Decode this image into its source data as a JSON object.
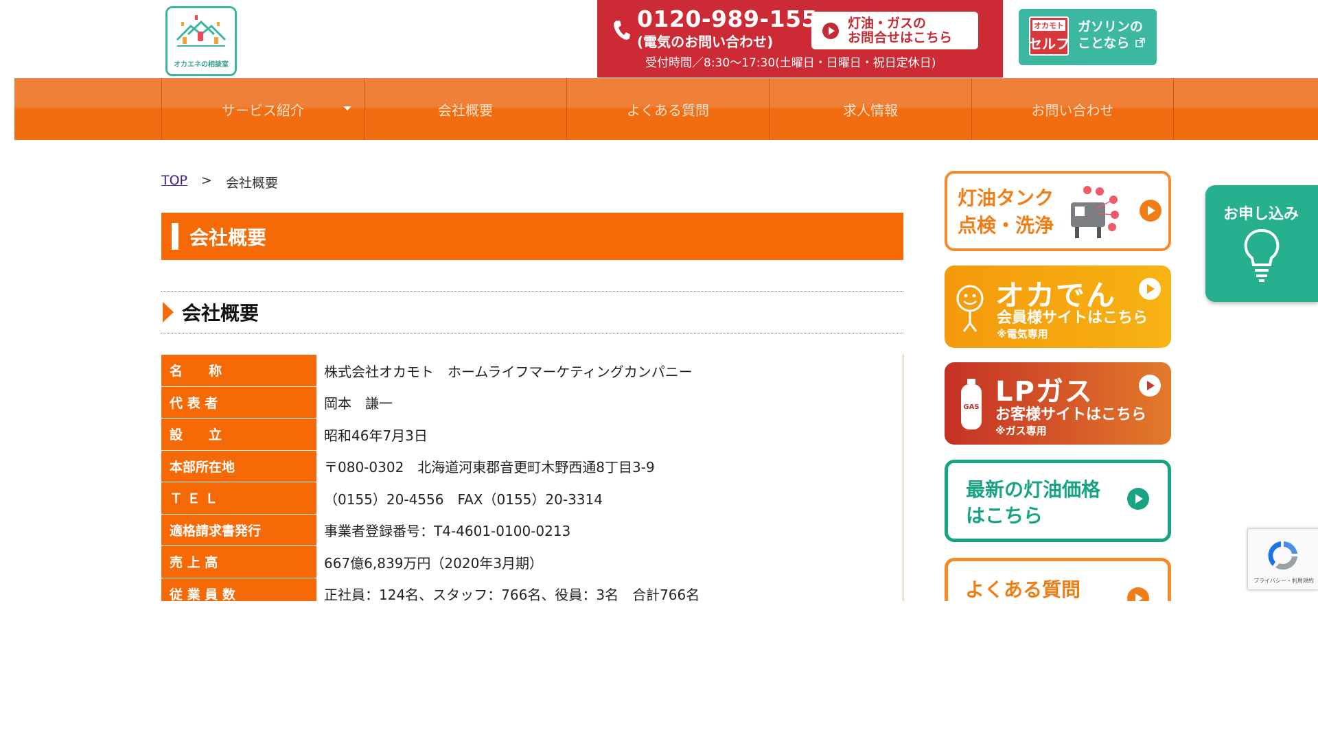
{
  "header": {
    "logo_text": "オカエネの相談室",
    "phone": {
      "number": "0120-989-155",
      "note": "(電気のお問い合わせ)",
      "hours": "受付時間／8:30〜17:30(土曜日・日曜日・祝日定休日)",
      "inquiry_button": "灯油・ガスの\nお問合せはこちら"
    },
    "gasoline": {
      "brand_top": "オカモト",
      "brand_main": "セルフ",
      "label": "ガソリンの\nことなら"
    }
  },
  "nav": {
    "items": [
      {
        "label": "サービス紹介"
      },
      {
        "label": "会社概要"
      },
      {
        "label": "よくある質問"
      },
      {
        "label": "求人情報"
      },
      {
        "label": "お問い合わせ"
      },
      {
        "label": ""
      }
    ]
  },
  "breadcrumb": {
    "top": "TOP",
    "separator": ">",
    "current": "会社概要"
  },
  "main": {
    "page_title": "会社概要",
    "section_title": "会社概要",
    "company_info": [
      {
        "key": "名　　称",
        "value": "株式会社オカモト　ホームライフマーケティングカンパニー"
      },
      {
        "key": "代 表 者",
        "value": "岡本　謙一"
      },
      {
        "key": "設　　立",
        "value": "昭和46年7月3日"
      },
      {
        "key": "本部所在地",
        "value": "〒080-0302　北海道河東郡音更町木野西通8丁目3-9"
      },
      {
        "key": "Ｔ Ｅ Ｌ",
        "value": "（0155）20-4556　FAX（0155）20-3314"
      },
      {
        "key": "適格請求書発行",
        "value": "事業者登録番号：T4-4601-0100-0213"
      },
      {
        "key": "売 上 高",
        "value": "667億6,839万円（2020年3月期）"
      },
      {
        "key": "従 業 員 数",
        "value": "正社員：124名、スタッフ：766名、役員：3名　合計766名"
      }
    ]
  },
  "sidebar": {
    "kerosene_tank": "灯油タンク\n点検・洗浄",
    "okaden": {
      "title": "オカでん",
      "sub": "会員様サイトはこちら",
      "note": "※電気専用"
    },
    "lpgas": {
      "title": "LPガス",
      "sub": "お客様サイトはこちら",
      "note": "※ガス専用",
      "cyl_label": "GAS"
    },
    "oil_price": "最新の灯油価格\nはこちら",
    "faq": "よくある質問"
  },
  "apply_tab": {
    "label": "お申し込み"
  },
  "recaptcha": {
    "text": "プライバシー・利用規約"
  },
  "colors": {
    "orange": "#f56a06",
    "nav_orange": "#ee8137",
    "phone_red": "#cc2b35",
    "teal": "#3cb8a0",
    "apply_green": "#27b08d"
  }
}
